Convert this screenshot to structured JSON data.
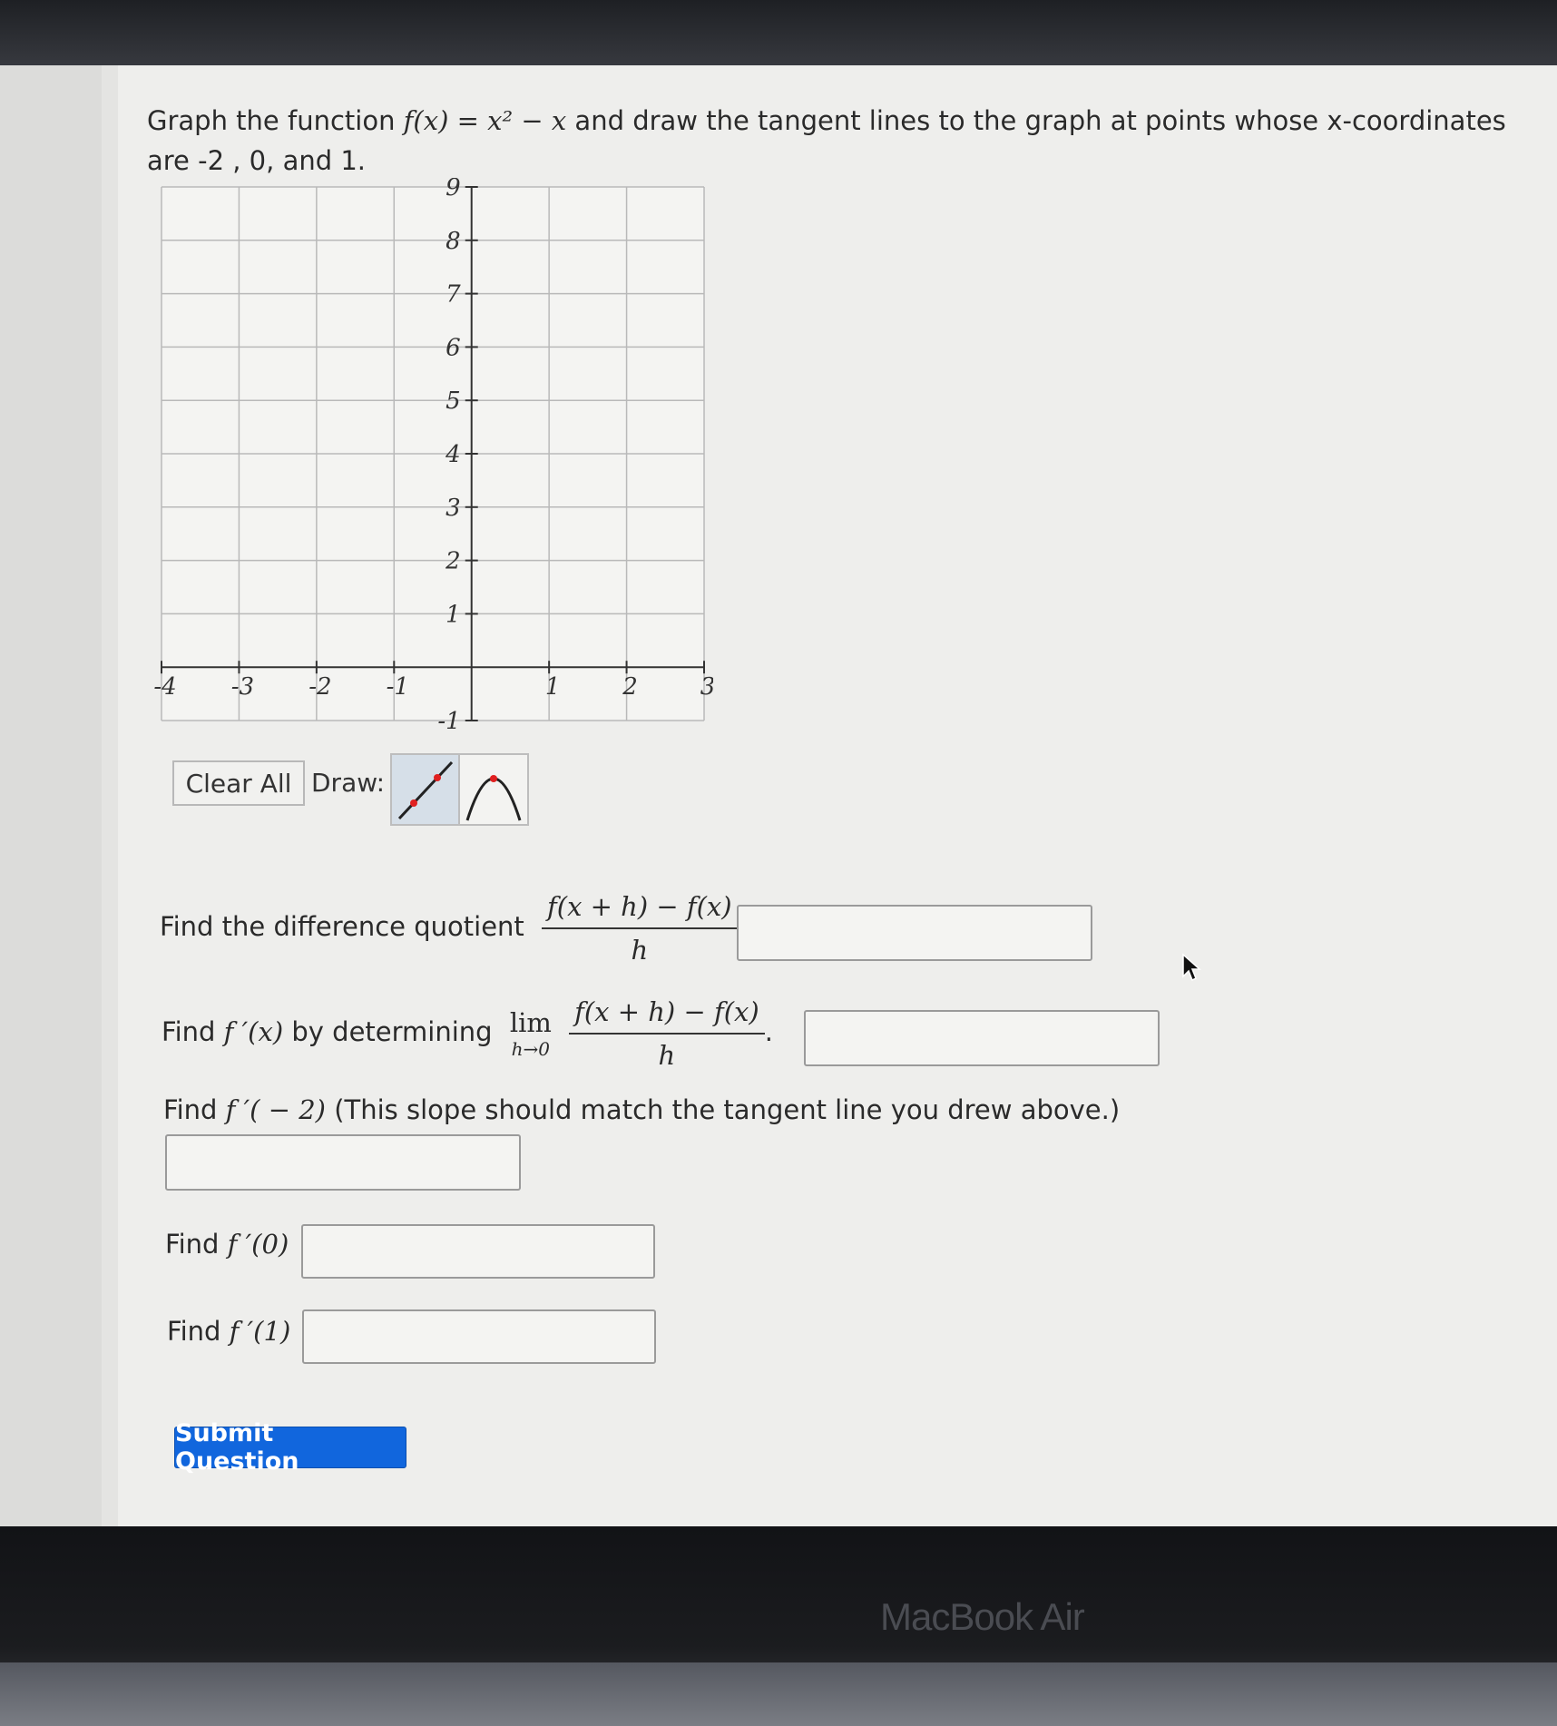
{
  "question": {
    "prompt_line1_a": "Graph the function",
    "prompt_func": "f(x) = x² − x",
    "prompt_line1_b": "and draw the tangent lines to the graph at points whose x-coordinates",
    "prompt_line2": "are -2 , 0, and 1."
  },
  "graph": {
    "x_ticks": [
      "-4",
      "-3",
      "-2",
      "-1",
      "1",
      "2",
      "3"
    ],
    "y_ticks": [
      "9",
      "8",
      "7",
      "6",
      "5",
      "4",
      "3",
      "2",
      "1",
      "-1"
    ],
    "xlim": [
      -4,
      3
    ],
    "ylim": [
      -1,
      9
    ]
  },
  "toolbar": {
    "clear_label": "Clear All",
    "draw_label": "Draw:",
    "tools": [
      "line-tool-icon",
      "parabola-tool-icon"
    ]
  },
  "q1": {
    "label": "Find the difference quotient",
    "numerator": "f(x + h) − f(x)",
    "denominator": "h"
  },
  "q2": {
    "label_a": "Find",
    "func": "f ′(x)",
    "label_b": "by determining",
    "lim": "lim",
    "lim_sub": "h→0",
    "numerator": "f(x + h) − f(x)",
    "denominator": "h",
    "period": "."
  },
  "q3": {
    "label_a": "Find",
    "func": "f ′( − 2)",
    "label_b": "(This slope should match the tangent line you drew above.)"
  },
  "q4": {
    "label_a": "Find",
    "func": "f ′(0)"
  },
  "q5": {
    "label_a": "Find",
    "func": "f ′(1)"
  },
  "submit_label": "Submit Question",
  "device_label": "MacBook Air",
  "colors": {
    "submit": "#1166dd",
    "tool_selected": "#d6dfe8",
    "tool_accent": "#e02020"
  }
}
